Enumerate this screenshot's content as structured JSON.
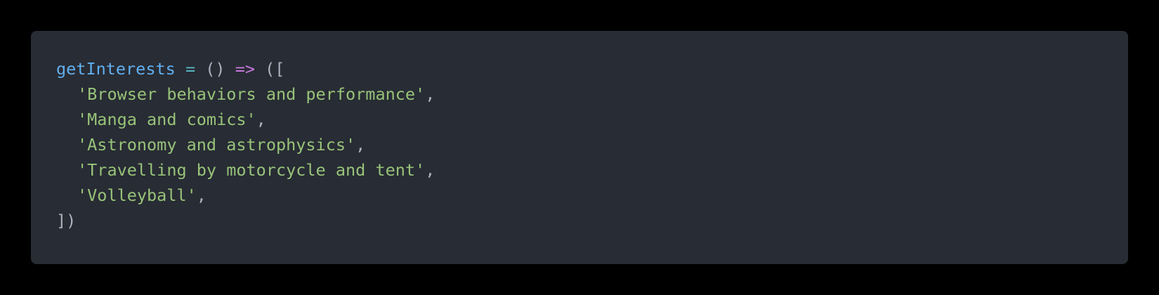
{
  "code": {
    "colors": {
      "background": "#282c34",
      "function": "#61afef",
      "operator": "#56b6c2",
      "arrow": "#c678dd",
      "string": "#98c379",
      "punctuation": "#abb2bf"
    },
    "line1": {
      "name": "getInterests",
      "assign": "=",
      "params": "()",
      "arrow": "=>",
      "open": "(["
    },
    "items": [
      "'Browser behaviors and performance'",
      "'Manga and comics'",
      "'Astronomy and astrophysics'",
      "'Travelling by motorcycle and tent'",
      "'Volleyball'"
    ],
    "comma": ",",
    "close": "])"
  }
}
